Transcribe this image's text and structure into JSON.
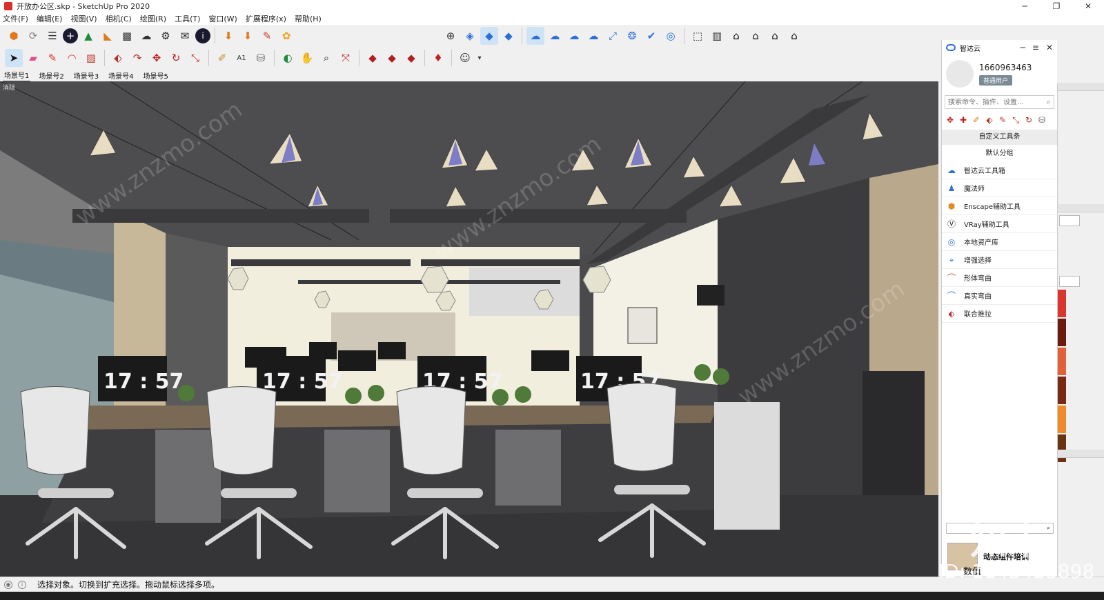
{
  "window": {
    "title": "开放办公区.skp - SketchUp Pro 2020",
    "controls": [
      "─",
      "❐",
      "✕"
    ]
  },
  "menu": [
    "文件(F)",
    "编辑(E)",
    "视图(V)",
    "相机(C)",
    "绘图(R)",
    "工具(T)",
    "窗口(W)",
    "扩展程序(x)",
    "帮助(H)"
  ],
  "toolbar1_icons": [
    "upload-icon",
    "refresh-icon",
    "list-icon",
    "add-icon",
    "tree-icon",
    "sheet-icon",
    "checker-icon",
    "cloud-up-icon",
    "gear-icon",
    "mail-icon",
    "info-icon",
    "download-icon",
    "download2-icon",
    "brush-icon",
    "flower-icon",
    "target-icon",
    "cube-icon",
    "cube2-icon",
    "cube3-icon",
    "cloud-link-icon",
    "cloud-search-icon",
    "cloud-icon",
    "cloud2-icon",
    "expand-icon",
    "network-icon",
    "check-icon",
    "chrome-icon",
    "box-icon",
    "book-icon",
    "house-icon",
    "house2-icon",
    "house3-icon",
    "house4-icon"
  ],
  "toolbar2_icons": [
    "select-icon",
    "eraser-icon",
    "pencil-icon",
    "arc-icon",
    "rectangle-icon",
    "push-pull-icon",
    "follow-icon",
    "move-icon",
    "rotate-icon",
    "scale-icon",
    "tape-icon",
    "text-icon",
    "paint-icon",
    "orbit-icon",
    "pan-icon",
    "zoom-icon",
    "zoom-extents-icon",
    "ruby-icon",
    "ruby2-icon",
    "ruby3-icon",
    "gem-icon",
    "user-icon"
  ],
  "scenes": [
    "场景号1",
    "场景号2",
    "场景号3",
    "场景号4",
    "场景号5"
  ],
  "active_scene": "场景号1",
  "viewport": {
    "label": "消除",
    "clock": "17 : 57"
  },
  "status": {
    "text": "选择对象。切换到扩充选择。拖动鼠标选择多项。"
  },
  "panel": {
    "title": "智达云",
    "user_id": "1660963463",
    "badge": "普通用户",
    "search_placeholder": "搜索命令、插件、设置...",
    "toolbar_section": "自定义工具条",
    "group_title": "默认分组",
    "plugins": [
      {
        "label": "智达云工具箱",
        "icon": "cloud-icon"
      },
      {
        "label": "魔法师",
        "icon": "wizard-icon"
      },
      {
        "label": "Enscape辅助工具",
        "icon": "enscape-icon"
      },
      {
        "label": "VRay辅助工具",
        "icon": "vray-icon"
      },
      {
        "label": "本地资产库",
        "icon": "asset-icon"
      },
      {
        "label": "增强选择",
        "icon": "select-plus-icon"
      },
      {
        "label": "形体弯曲",
        "icon": "bend-icon"
      },
      {
        "label": "真实弯曲",
        "icon": "real-bend-icon"
      },
      {
        "label": "联合推拉",
        "icon": "joint-push-icon"
      }
    ],
    "footer_item": "动态组件培训",
    "footer_value": "数值"
  },
  "tray_swatches": [
    "#d8362f",
    "#6b1a10",
    "#e2603a",
    "#7a2a14",
    "#f08a2a",
    "#6a3414"
  ],
  "watermark": {
    "brand": "知末",
    "id": "ID: 1143423898",
    "url": "www.znzmo.com"
  }
}
